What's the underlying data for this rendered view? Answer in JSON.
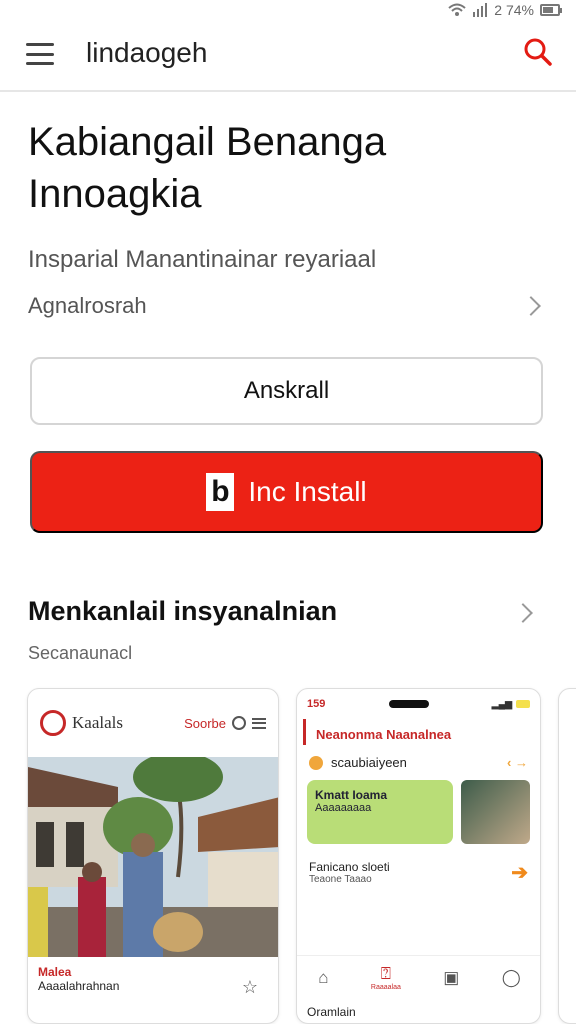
{
  "status_bar": {
    "signal_text": "2 74%",
    "battery_level": 0.74
  },
  "app_bar": {
    "title": "lindaogeh",
    "menu_icon": "hamburger-menu-icon",
    "search_icon": "search-icon",
    "accent_color": "#e31b13"
  },
  "hero": {
    "title": "Kabiangail Benanga Innoagkia",
    "subtitle": "Insparial Manantinainar reyariaal",
    "link_label": "Agnalrosrah"
  },
  "buttons": {
    "outline_label": "Anskrall",
    "primary_label": "Inc Install",
    "primary_logo": "b",
    "primary_color": "#ec2215"
  },
  "section": {
    "title": "Menkanlail insyanalnian",
    "subtitle": "Secanaunacl"
  },
  "card1": {
    "brand": "Kaalals",
    "brand_sub": "",
    "search_label": "Soorbe",
    "caption_tag": "Malea",
    "caption_text": "Aaaalahrahnan"
  },
  "card2": {
    "time": "159",
    "title": "Neanonma Naanalnea",
    "row_text": "scaubiaiyeen",
    "banner_text": "Kmatt Ioama",
    "banner_sub": "Aaaaaaaaa",
    "fav_title": "Fanicano sloeti",
    "fav_sub": "Teaone Taaao",
    "nav_active_label": "Raaaalaa",
    "bottom_text": "Oramlain"
  }
}
